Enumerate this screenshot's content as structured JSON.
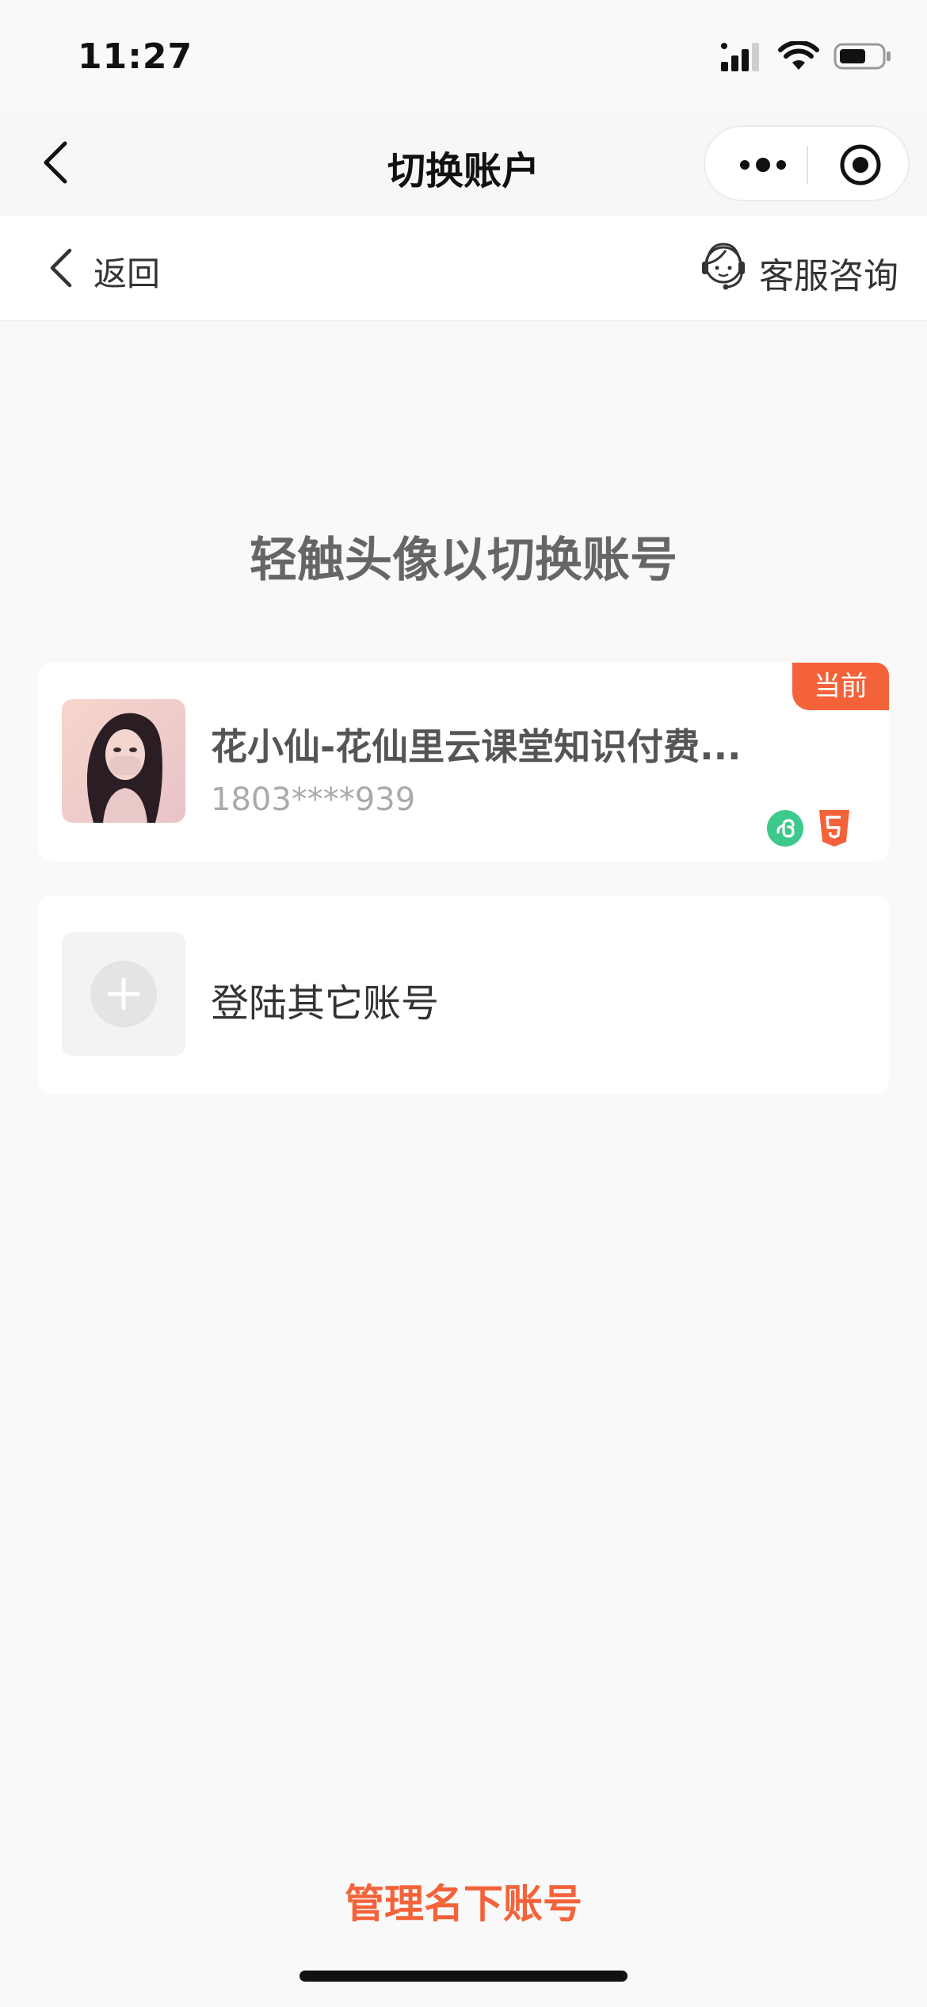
{
  "status_bar": {
    "time": "11:27"
  },
  "navbar": {
    "title": "切换账户"
  },
  "subheader": {
    "back_label": "返回",
    "service_label": "客服咨询"
  },
  "hint": "轻触头像以切换账号",
  "current_account": {
    "badge": "当前",
    "name": "花小仙-花仙里云课堂知识付费...",
    "phone": "1803****939"
  },
  "add_account": {
    "label": "登陆其它账号"
  },
  "footer": {
    "manage_label": "管理名下账号"
  },
  "colors": {
    "accent": "#f4623a",
    "background": "#f9f9f9",
    "mini_program_green": "#3dc98c"
  }
}
